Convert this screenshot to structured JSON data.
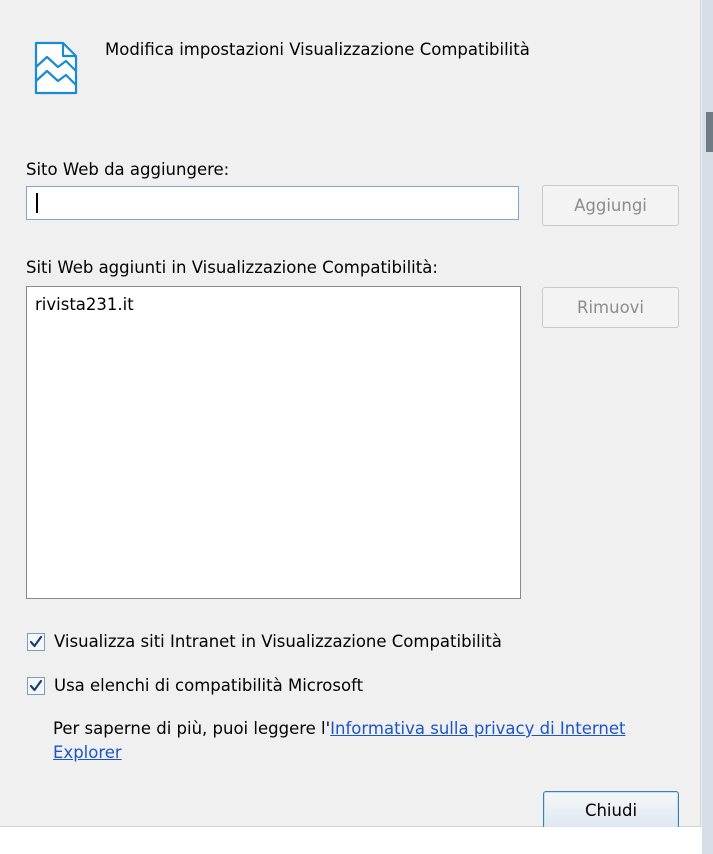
{
  "dialog": {
    "icon": "compatibility-view-icon",
    "title": "Modifica impostazioni Visualizzazione Compatibilità"
  },
  "add_section": {
    "label": "Sito Web da aggiungere:",
    "input_value": "",
    "add_button": "Aggiungi"
  },
  "list_section": {
    "label": "Siti Web aggiunti in Visualizzazione Compatibilità:",
    "items": [
      "rivista231.it"
    ],
    "remove_button": "Rimuovi"
  },
  "options": {
    "intranet": {
      "label": "Visualizza siti Intranet in Visualizzazione Compatibilità",
      "checked": true
    },
    "microsoft_lists": {
      "label": "Usa elenchi di compatibilità Microsoft",
      "checked": true
    }
  },
  "info": {
    "text": "Per saperne di più, puoi leggere l'",
    "link": "Informativa sulla privacy di Internet Explorer"
  },
  "footer": {
    "close_button": "Chiudi"
  },
  "colors": {
    "link": "#1c55c4",
    "focus_border": "#7aa7d6",
    "default_button_border": "#3c7fb1"
  }
}
